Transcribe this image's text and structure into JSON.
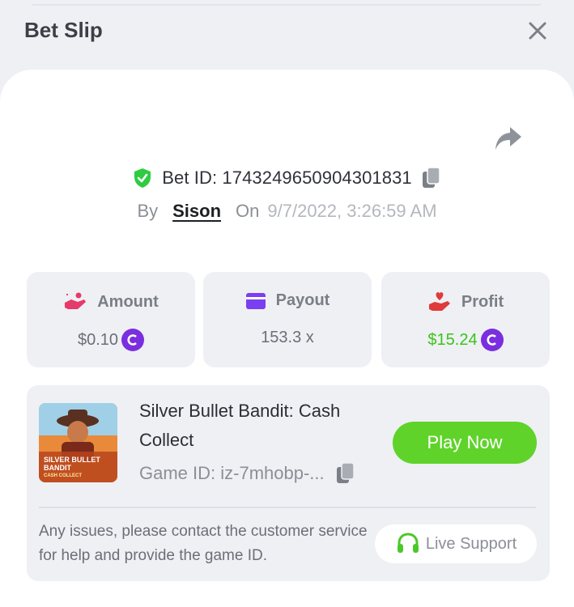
{
  "header": {
    "title": "Bet Slip"
  },
  "bet": {
    "id_text": "Bet ID: 1743249650904301831",
    "by_label": "By",
    "user": "Sison",
    "on_label": "On",
    "date": "9/7/2022, 3:26:59 AM"
  },
  "stats": [
    {
      "label": "Amount",
      "value": "$0.10",
      "coin": true
    },
    {
      "label": "Payout",
      "value": "153.3 x",
      "coin": false
    },
    {
      "label": "Profit",
      "value": "$15.24",
      "coin": true
    }
  ],
  "game": {
    "title": "Silver Bullet Bandit: Cash Collect",
    "id_text": "Game ID: iz-7mhobp-...",
    "thumb_line1": "SILVER BULLET",
    "thumb_line2": "BANDIT",
    "thumb_line3": "CASH COLLECT",
    "play_label": "Play Now",
    "issues_text": "Any issues, please contact the customer service for help and provide the game ID.",
    "support_label": "Live Support"
  },
  "colors": {
    "accent_green": "#5fd32a",
    "profit_green": "#3cc318",
    "coin_purple": "#7a2ee0",
    "amount_icon": "#e63a6a",
    "payout_icon": "#7a3ff0",
    "profit_icon": "#e03a3a",
    "shield_green": "#2ecc40"
  },
  "icons": {
    "close": "close-icon",
    "share": "share-arrow-icon",
    "verified": "shield-check-icon",
    "copy": "copy-icon",
    "amount": "hand-coins-icon",
    "payout": "card-icon",
    "profit": "hand-heart-icon",
    "coin": "coin-icon",
    "support": "headset-icon"
  }
}
